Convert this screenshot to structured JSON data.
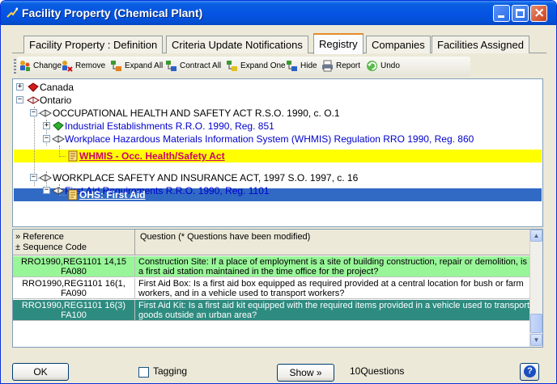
{
  "window": {
    "title": "Facility Property  (Chemical Plant)",
    "controls": {
      "minimize": "minimize",
      "maximize": "maximize",
      "close": "×"
    }
  },
  "tabs": [
    {
      "label": "Facility Property : Definition",
      "active": false
    },
    {
      "label": "Criteria Update Notifications",
      "active": false
    },
    {
      "label": "Registry",
      "active": true
    },
    {
      "label": "Companies",
      "active": false
    },
    {
      "label": "Facilities Assigned",
      "active": false
    }
  ],
  "toolbar": {
    "change": "Change",
    "remove": "Remove",
    "expand_all": "Expand All",
    "contract_all": "Contract All",
    "expand_one": "Expand One",
    "hide": "Hide",
    "report": "Report",
    "undo": "Undo"
  },
  "tree": {
    "nodes": [
      {
        "text": "Canada",
        "level": 0,
        "expander": "+",
        "icon": "red-book-icon"
      },
      {
        "text": "Ontario",
        "level": 0,
        "expander": "−",
        "icon": "open-book-icon"
      },
      {
        "text": "OCCUPATIONAL HEALTH AND SAFETY ACT  R.S.O. 1990, c. O.1",
        "level": 1,
        "expander": "−",
        "icon": "open-book-icon"
      },
      {
        "text": "Industrial Establishments  R.R.O. 1990, Reg. 851",
        "level": 2,
        "expander": "+",
        "icon": "green-book-icon"
      },
      {
        "text": "Workplace Hazardous Materials Information System (WHMIS) Regulation  RRO 1990, Reg. 860",
        "level": 2,
        "expander": "−",
        "icon": "open-book-icon"
      },
      {
        "text": "WHMIS - Occ. Health/Safety Act",
        "level": 3,
        "expander": "",
        "icon": "document-icon",
        "highlight": "yellow"
      },
      {
        "text": "WORKPLACE SAFETY AND INSURANCE ACT, 1997  S.O. 1997, c. 16",
        "level": 1,
        "expander": "−",
        "icon": "open-book-icon"
      },
      {
        "text": "First Aid Requirements  R.R.O. 1990, Reg. 1101",
        "level": 2,
        "expander": "−",
        "icon": "open-book-icon"
      },
      {
        "text": "OHS: First Aid",
        "level": 3,
        "expander": "",
        "icon": "document-icon",
        "highlight": "selected"
      }
    ]
  },
  "grid": {
    "header": {
      "ref_line1": "» Reference",
      "ref_line2": "±      Sequence Code",
      "question": "Question (* Questions have been modified)"
    },
    "rows": [
      {
        "reference": "RRO1990,REG1101 14,15",
        "code": "FA080",
        "question": "Construction Site: If a place of employment is a site of building construction, repair or demolition, is a first aid station maintained in the time office for the project?",
        "bg": "#98f598",
        "color": "#000000"
      },
      {
        "reference": "RRO1990,REG1101 16(1,",
        "code": "FA090",
        "question": "First Aid Box: Is a first aid box equipped as required provided at a central location for bush or farm workers, and in a vehicle used to transport workers?",
        "bg": "#ffffff",
        "color": "#000000"
      },
      {
        "reference": "RRO1990,REG1101 16(3)",
        "code": "FA100",
        "question": "First Aid Kit: Is a first aid kit equipped with the required items provided in a vehicle used to transport goods outside an urban area?",
        "bg": "#2e8b80",
        "color": "#ffffff"
      }
    ]
  },
  "footer": {
    "ok": "OK",
    "tagging": "Tagging",
    "show": "Show »",
    "count": "10Questions",
    "help": "?"
  },
  "colors": {
    "titlebar": "#0554e3",
    "active_tab_accent": "#e68b2c",
    "selection": "#316ac5",
    "highlight_yellow": "#ffff00",
    "row_green": "#98f598",
    "row_teal": "#2e8b80"
  }
}
